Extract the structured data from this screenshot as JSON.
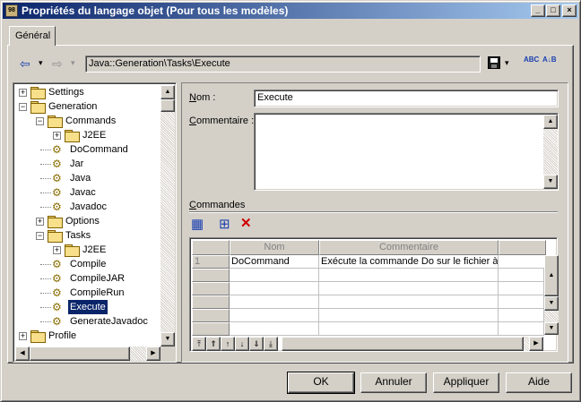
{
  "window": {
    "title": "Propriétés du langage objet (Pour tous les modèles)",
    "app_icon_text": "98",
    "controls": {
      "minimize": "_",
      "maximize": "□",
      "close": "×"
    }
  },
  "tabs": [
    {
      "label": "Général",
      "active": true
    }
  ],
  "toolbar": {
    "back_glyph": "⇦",
    "dropdown_glyph": "▾",
    "forward_glyph": "⇨",
    "path": "Java::Generation\\Tasks\\Execute",
    "save_glyph": "💾",
    "spell_glyph": "ABC",
    "sort_glyph": "A↓B"
  },
  "tree": {
    "items": [
      {
        "label": "Settings",
        "icon": "folder",
        "depth": 0,
        "expander": "+"
      },
      {
        "label": "Generation",
        "icon": "folder",
        "depth": 0,
        "expander": "−"
      },
      {
        "label": "Commands",
        "icon": "folder",
        "depth": 1,
        "expander": "−"
      },
      {
        "label": "J2EE",
        "icon": "folder",
        "depth": 2,
        "expander": "+"
      },
      {
        "label": "DoCommand",
        "icon": "gear",
        "depth": 2,
        "expander": ""
      },
      {
        "label": "Jar",
        "icon": "gear",
        "depth": 2,
        "expander": ""
      },
      {
        "label": "Java",
        "icon": "gear",
        "depth": 2,
        "expander": ""
      },
      {
        "label": "Javac",
        "icon": "gear",
        "depth": 2,
        "expander": ""
      },
      {
        "label": "Javadoc",
        "icon": "gear",
        "depth": 2,
        "expander": ""
      },
      {
        "label": "Options",
        "icon": "folder",
        "depth": 1,
        "expander": "+"
      },
      {
        "label": "Tasks",
        "icon": "folder",
        "depth": 1,
        "expander": "−"
      },
      {
        "label": "J2EE",
        "icon": "folder",
        "depth": 2,
        "expander": "+"
      },
      {
        "label": "Compile",
        "icon": "gear",
        "depth": 2,
        "expander": ""
      },
      {
        "label": "CompileJAR",
        "icon": "gear",
        "depth": 2,
        "expander": ""
      },
      {
        "label": "CompileRun",
        "icon": "gear",
        "depth": 2,
        "expander": ""
      },
      {
        "label": "Execute",
        "icon": "gear",
        "depth": 2,
        "expander": "",
        "selected": true
      },
      {
        "label": "GenerateJavadoc",
        "icon": "gear",
        "depth": 2,
        "expander": ""
      },
      {
        "label": "Profile",
        "icon": "folder",
        "depth": 0,
        "expander": "+"
      }
    ]
  },
  "form": {
    "nom_label": "Nom :",
    "nom_label_accel": "N",
    "nom_label_rest": "om :",
    "nom_value": "Execute",
    "comment_label_accel": "C",
    "comment_label_rest": "ommentaire :",
    "comment_value": "",
    "commands_label_accel": "C",
    "commands_label_rest": "ommandes"
  },
  "grid": {
    "columns": [
      "Nom",
      "Commentaire"
    ],
    "rows": [
      {
        "index": "1",
        "nom": "DoCommand",
        "commentaire": "Exécute la commande Do sur le fichier à"
      }
    ],
    "empty_rows": 5,
    "nav_glyphs": [
      "⤒",
      "⇑",
      "↑",
      "↓",
      "⇓",
      "⤓"
    ]
  },
  "grid_toolbar": {
    "properties_glyph": "▦",
    "add_glyph": "⊞",
    "delete_glyph": "✕"
  },
  "buttons": {
    "ok": "OK",
    "cancel": "Annuler",
    "apply": "Appliquer",
    "help": "Aide"
  },
  "scroll": {
    "up": "▲",
    "down": "▼",
    "left": "◀",
    "right": "▶"
  },
  "colors": {
    "title_start": "#0a246a",
    "title_end": "#a6caf0",
    "selection": "#0a246a",
    "delete_red": "#d00000"
  }
}
